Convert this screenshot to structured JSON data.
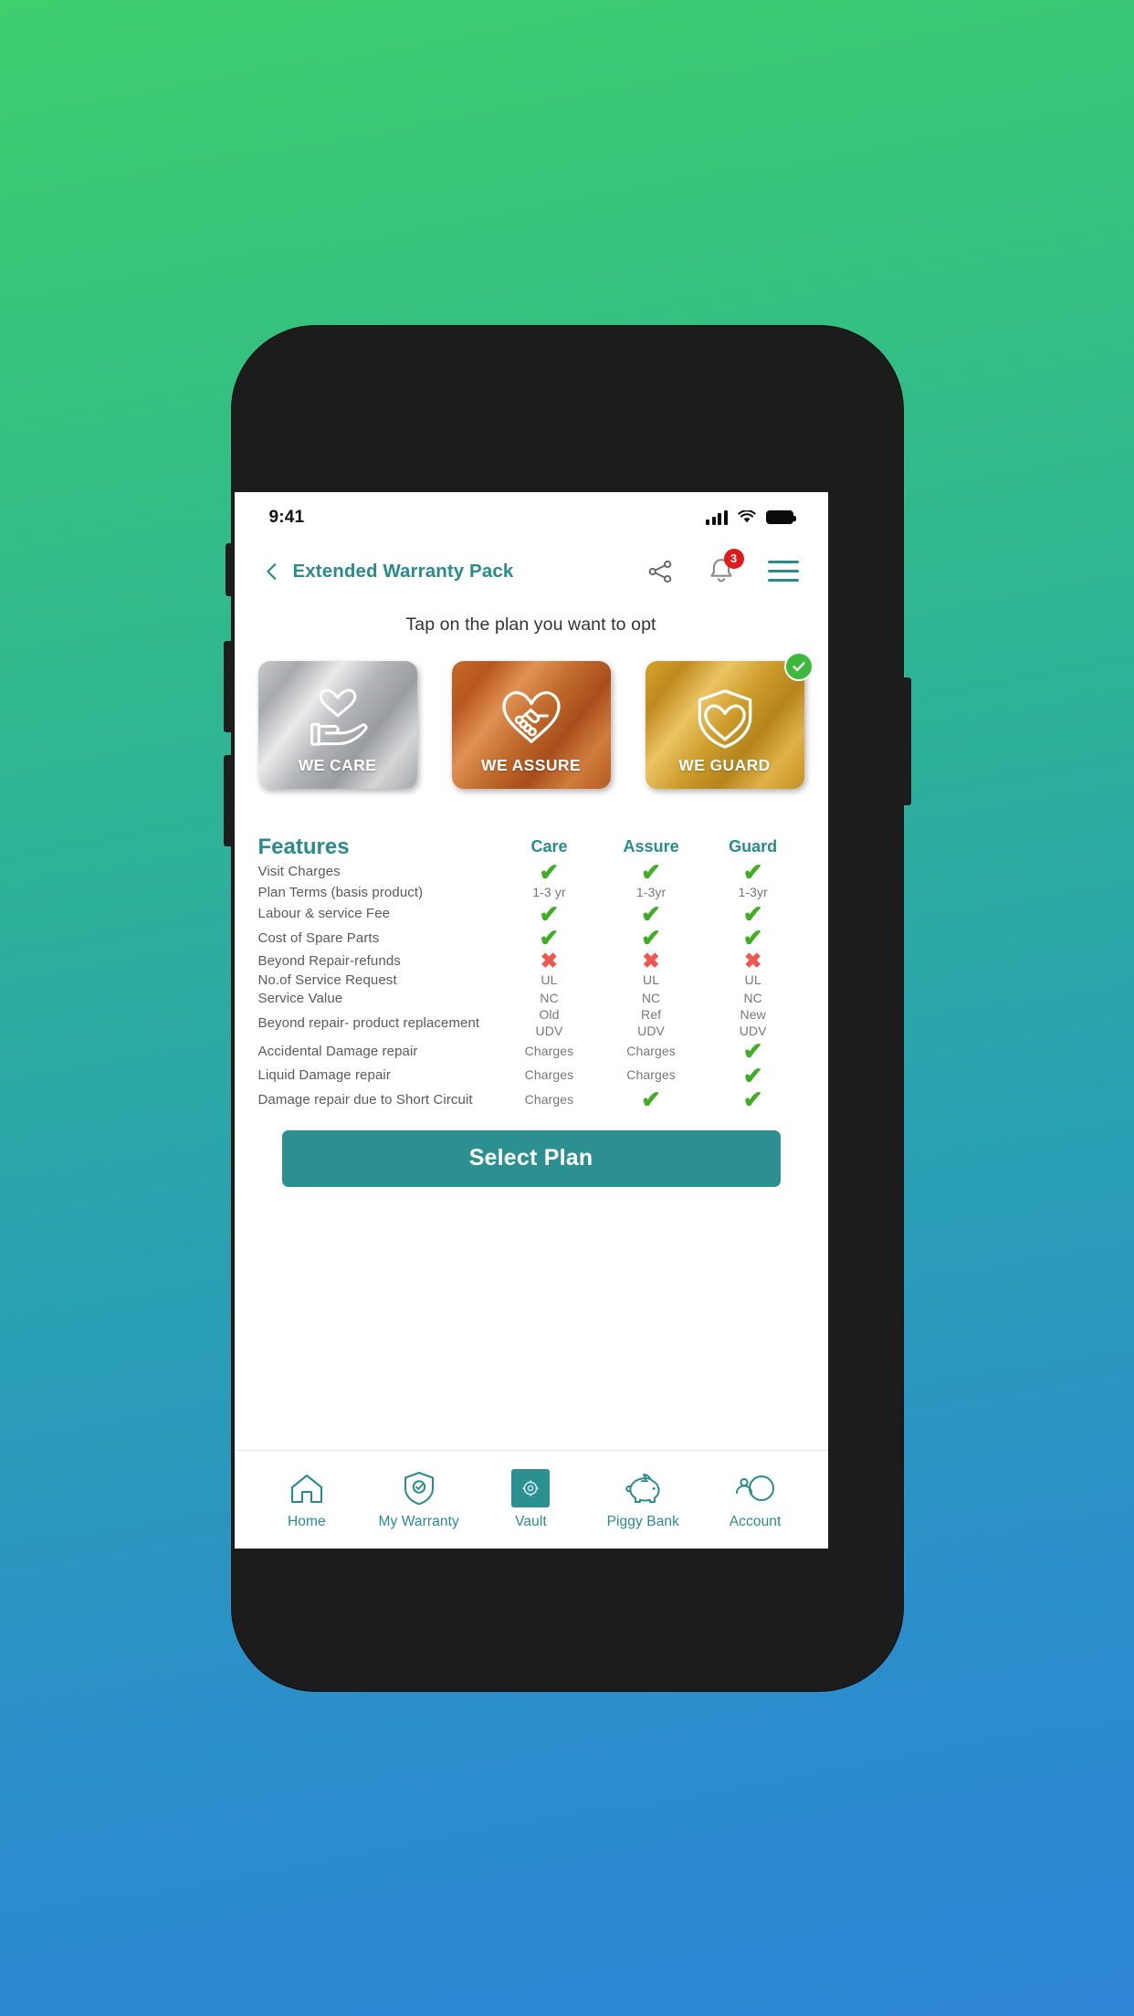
{
  "status_bar": {
    "time": "9:41",
    "signal_icon": "cellular-signal-icon",
    "wifi_icon": "wifi-icon",
    "battery_icon": "battery-full-icon"
  },
  "app_bar": {
    "back_icon": "back-chevron-icon",
    "title": "Extended Warranty Pack",
    "share_icon": "share-icon",
    "notification_icon": "bell-icon",
    "notification_count": "3",
    "menu_icon": "hamburger-menu-icon"
  },
  "prompt": "Tap on the plan you want to opt",
  "plans": [
    {
      "label": "WE CARE",
      "icon": "heart-in-hand-icon",
      "tier": "silver",
      "selected": false
    },
    {
      "label": "WE ASSURE",
      "icon": "handshake-heart-icon",
      "tier": "bronze",
      "selected": false
    },
    {
      "label": "WE GUARD",
      "icon": "shield-heart-icon",
      "tier": "gold",
      "selected": true
    }
  ],
  "selected_badge_icon": "check-circle-icon",
  "table": {
    "feature_header": "Features",
    "columns": [
      "Care",
      "Assure",
      "Guard"
    ],
    "rows": [
      {
        "feature": "Visit Charges",
        "values": [
          "tick",
          "tick",
          "tick"
        ]
      },
      {
        "feature": "Plan Terms (basis product)",
        "values": [
          "1-3 yr",
          "1-3yr",
          "1-3yr"
        ]
      },
      {
        "feature": "Labour & service Fee",
        "values": [
          "tick",
          "tick",
          "tick"
        ]
      },
      {
        "feature": "Cost of Spare Parts",
        "values": [
          "tick",
          "tick",
          "tick"
        ]
      },
      {
        "feature": "Beyond Repair-refunds",
        "values": [
          "",
          "cross",
          "cross",
          "cross"
        ]
      },
      {
        "feature": "No.of Service Request",
        "values": [
          "UL",
          "UL",
          "UL"
        ]
      },
      {
        "feature": "Service Value",
        "values": [
          "NC",
          "NC",
          "NC"
        ]
      },
      {
        "feature": "Beyond repair- product replacement",
        "values": [
          "Old\nUDV",
          "Ref\nUDV",
          "New\nUDV"
        ]
      },
      {
        "feature": "Accidental Damage repair",
        "values": [
          "Charges",
          "Charges",
          "tick"
        ]
      },
      {
        "feature": "Liquid Damage repair",
        "values": [
          "Charges",
          "Charges",
          "tick"
        ]
      },
      {
        "feature": "Damage repair due to Short Circuit",
        "values": [
          "Charges",
          "tick",
          "tick"
        ]
      }
    ]
  },
  "cta": {
    "label": "Select Plan"
  },
  "bottom_nav": [
    {
      "label": "Home",
      "icon": "home-icon",
      "active": false
    },
    {
      "label": "My Warranty",
      "icon": "shield-check-icon",
      "active": false
    },
    {
      "label": "Vault",
      "icon": "vault-icon",
      "active": true
    },
    {
      "label": "Piggy Bank",
      "icon": "piggy-bank-icon",
      "active": false
    },
    {
      "label": "Account",
      "icon": "account-icon",
      "active": false
    }
  ],
  "colors": {
    "teal": "#2b8b8b",
    "cta": "#2c8f90",
    "tick_green": "#3fae22",
    "cross_red": "#f0564e",
    "badge_red": "#e01b1b",
    "selected_green": "#3cb93c"
  }
}
